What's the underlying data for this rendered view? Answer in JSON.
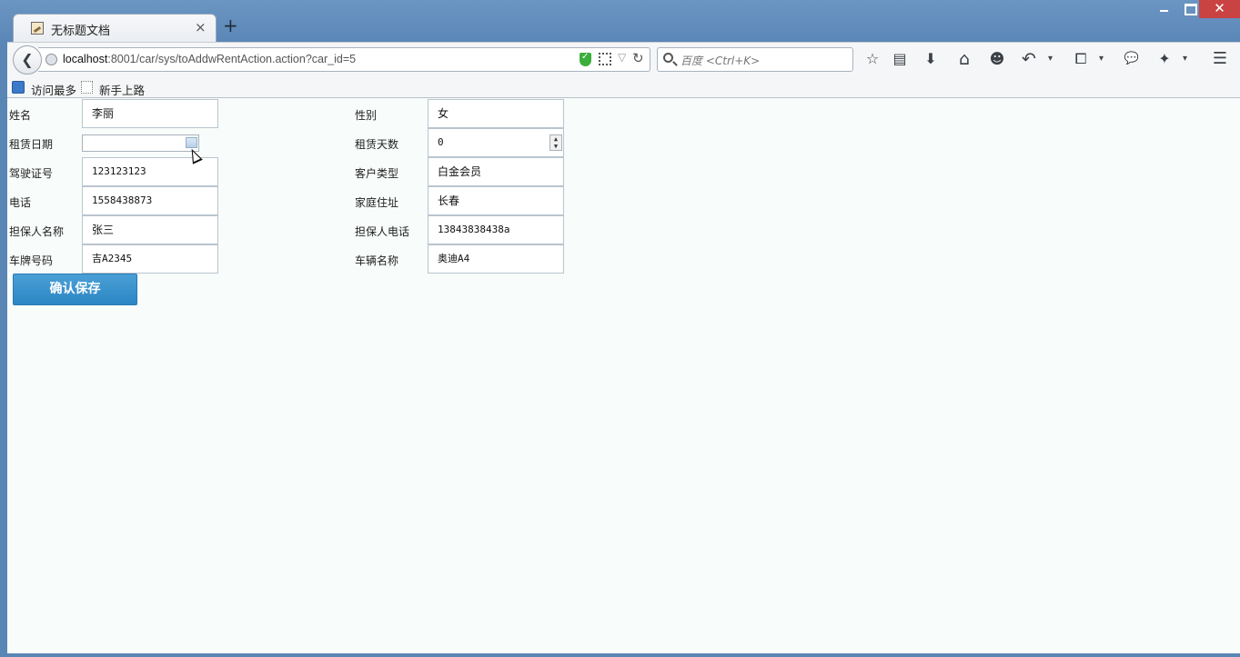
{
  "window": {
    "tab_title": "无标题文档",
    "tab_close": "×",
    "new_tab": "+",
    "close_glyph": "✕"
  },
  "navbar": {
    "back_glyph": "❮",
    "url_host": "localhost",
    "url_rest": ":8001/car/sys/toAddwRentAction.action?car_id=5",
    "search_placeholder": "百度 <Ctrl+K>",
    "reload_glyph": "↻",
    "dropdown_glyph": "▽"
  },
  "toolbar": {
    "icons": [
      "bookmark-star-icon",
      "reading-list-icon",
      "downloads-icon",
      "home-icon",
      "emoji-icon",
      "undo-icon",
      "crop-screenshot-icon",
      "chat-icon",
      "plugin-icon",
      "menu-icon"
    ],
    "star": "☆",
    "reading": "▤",
    "download": "⬇",
    "home": "⌂",
    "emoji": "☻",
    "undo": "↶",
    "crop": "⧠",
    "chat": "💬",
    "plugin": "✦",
    "menu": "☰",
    "caret": "▾"
  },
  "bookmarks": {
    "most_visited": "访问最多",
    "getting_started": "新手上路"
  },
  "form": {
    "fields": [
      {
        "label": "姓名",
        "value": "李丽"
      },
      {
        "label": "性别",
        "value": "女"
      },
      {
        "label": "租赁日期",
        "value": ""
      },
      {
        "label": "租赁天数",
        "value": "0"
      },
      {
        "label": "驾驶证号",
        "value": "123123123"
      },
      {
        "label": "客户类型",
        "value": "白金会员"
      },
      {
        "label": "电话",
        "value": "1558438873"
      },
      {
        "label": "家庭住址",
        "value": "长春"
      },
      {
        "label": "担保人名称",
        "value": "张三"
      },
      {
        "label": "担保人电话",
        "value": "13843838438a"
      },
      {
        "label": "车牌号码",
        "value": "吉A2345"
      },
      {
        "label": "车辆名称",
        "value": "奥迪A4"
      }
    ],
    "spinner_up": "▲",
    "spinner_down": "▼",
    "submit_label": "确认保存"
  }
}
